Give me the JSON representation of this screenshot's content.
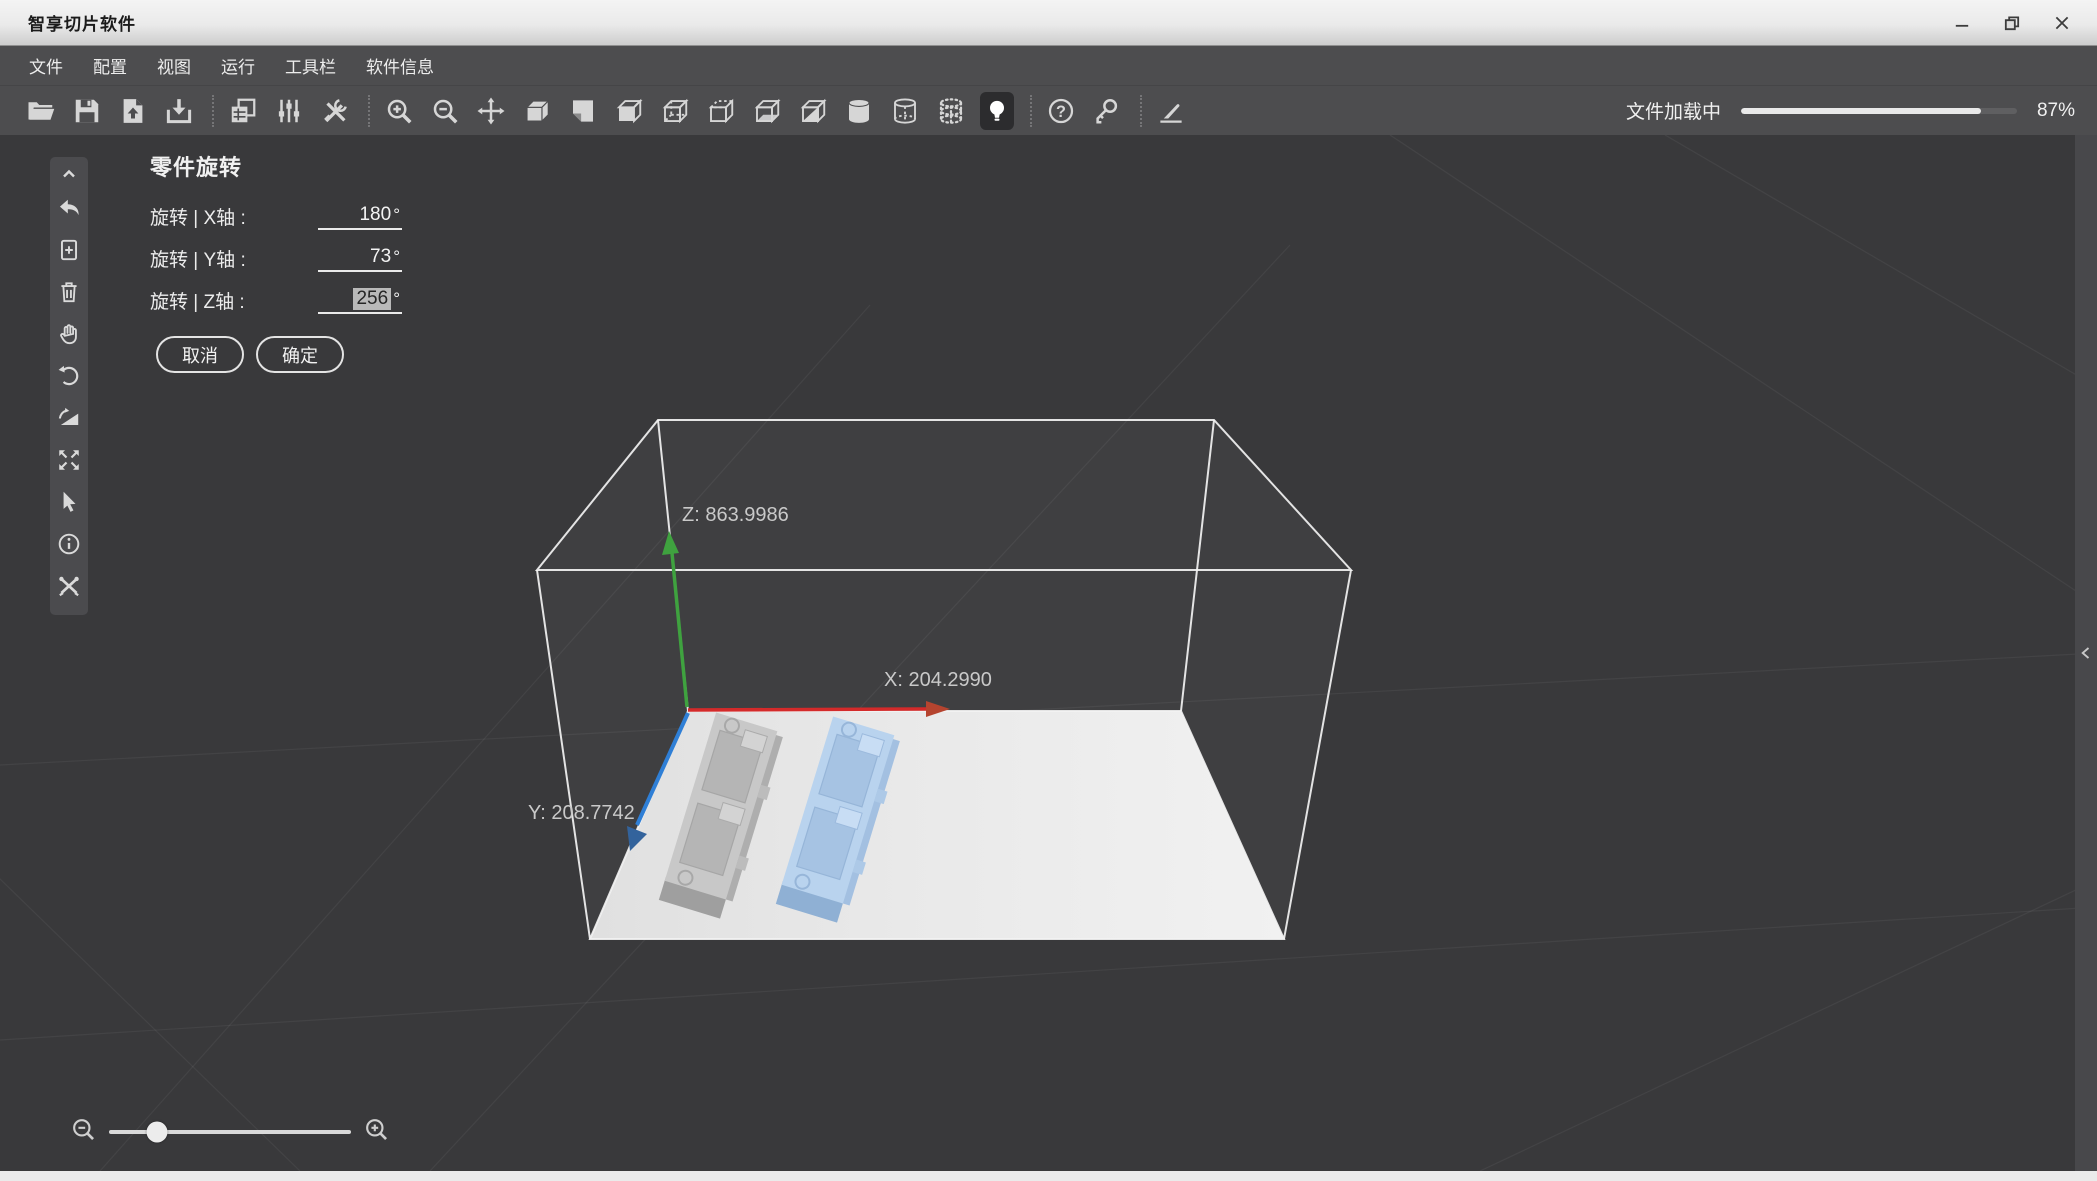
{
  "window": {
    "title": "智享切片软件",
    "controls": [
      "minimize",
      "restore",
      "close"
    ]
  },
  "menu": {
    "items": [
      {
        "label": "文件"
      },
      {
        "label": "配置"
      },
      {
        "label": "视图"
      },
      {
        "label": "运行"
      },
      {
        "label": "工具栏"
      },
      {
        "label": "软件信息"
      }
    ]
  },
  "toolbar": {
    "icons": [
      "open-file",
      "save",
      "import-model",
      "export-model",
      "|",
      "duplicate",
      "adjust-parameters",
      "tools",
      "|",
      "zoom-in",
      "zoom-out",
      "move",
      "view-solid",
      "view-sheet",
      "view-shaded",
      "view-hidden-edges",
      "view-dashed-top",
      "view-bottom",
      "view-section",
      "cylinder-solid",
      "cylinder-wireframe",
      "cylinder-points",
      "light-on",
      "|",
      "help",
      "license-key",
      "|",
      "cut-tool"
    ],
    "active_icon": "light-on",
    "progress": {
      "label": "文件加载中",
      "value": 87,
      "percent_text": "87%"
    }
  },
  "side_toolbar": {
    "icons": [
      "collapse-up",
      "undo",
      "add-part",
      "delete-part",
      "pan-hand",
      "rotate",
      "lay-flat",
      "fit-view",
      "select-cursor",
      "part-info",
      "repair-tools"
    ]
  },
  "rotation_panel": {
    "title": "零件旋转",
    "rows": [
      {
        "label": "旋转 | X轴 :",
        "value": "180",
        "unit": "°",
        "selected": false
      },
      {
        "label": "旋转 | Y轴 :",
        "value": "73",
        "unit": "°",
        "selected": false
      },
      {
        "label": "旋转 | Z轴 :",
        "value": "256",
        "unit": "°",
        "selected": true
      }
    ],
    "cancel_label": "取消",
    "confirm_label": "确定"
  },
  "viewport": {
    "axis_labels": {
      "z": "Z: 863.9986",
      "x": "X: 204.2990",
      "y": "Y: 208.7742"
    },
    "colors": {
      "background": "#39393b",
      "x_axis": "#d03a2b",
      "y_axis": "#2f7fd6",
      "z_axis": "#3fa23f",
      "box_edge": "#f2f2f2",
      "plate": "#e9e9e9",
      "model_gray": "#c8c8c8",
      "model_blue": "#b9d3ee"
    },
    "models": [
      {
        "name": "model-gray"
      },
      {
        "name": "model-blue"
      }
    ]
  },
  "zoom_control": {
    "position_percent": 20,
    "min_icon": "zoom-out",
    "max_icon": "zoom-in"
  },
  "right_panel_handle": {
    "icon": "chevron-left"
  }
}
